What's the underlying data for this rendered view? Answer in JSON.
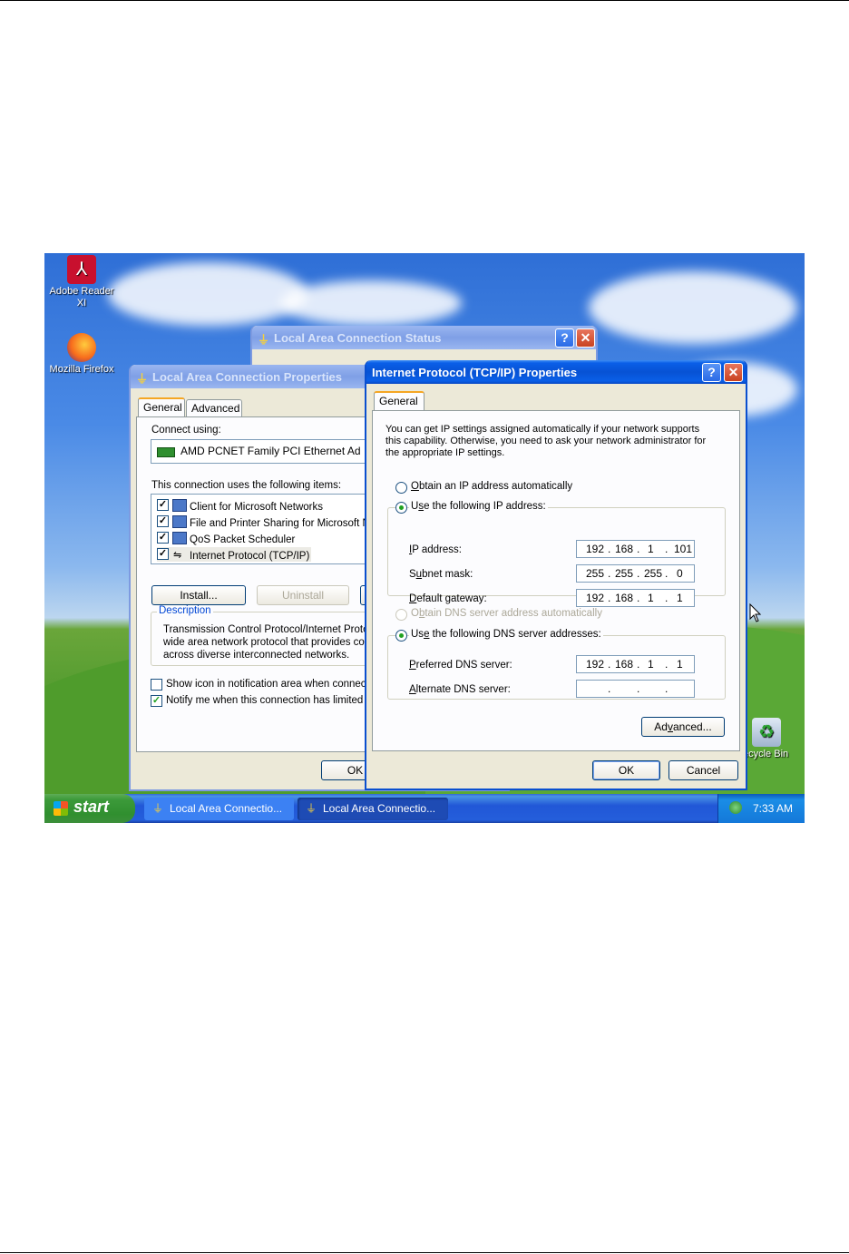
{
  "desktop": {
    "icons": [
      {
        "label": "Adobe Reader XI",
        "icon": "adobe-reader-icon"
      },
      {
        "label": "Mozilla Firefox",
        "icon": "firefox-icon"
      },
      {
        "label": "ecycle Bin",
        "icon": "recycle-bin-icon"
      }
    ]
  },
  "status_window": {
    "title": "Local Area Connection Status",
    "help": "?",
    "close": "✕"
  },
  "lan_props": {
    "title": "Local Area Connection Properties",
    "tabs": [
      "General",
      "Advanced"
    ],
    "connect_using_label": "Connect using:",
    "adapter": "AMD PCNET Family PCI Ethernet Ad",
    "items_label": "This connection uses the following items:",
    "items": [
      {
        "label": "Client for Microsoft Networks",
        "checked": true
      },
      {
        "label": "File and Printer Sharing for Microsoft N",
        "checked": true
      },
      {
        "label": "QoS Packet Scheduler",
        "checked": true
      },
      {
        "label": "Internet Protocol (TCP/IP)",
        "checked": true
      }
    ],
    "install_button": "Install...",
    "uninstall_button": "Uninstall",
    "description_legend": "Description",
    "description_lines": [
      "Transmission Control Protocol/Internet Protoc",
      "wide area network protocol that provides com",
      "across diverse interconnected networks."
    ],
    "show_icon_label": "Show icon in notification area when connect",
    "notify_label": "Notify me when this connection has limited o",
    "ok_button": "OK"
  },
  "tcpip": {
    "title": "Internet Protocol (TCP/IP) Properties",
    "help": "?",
    "close": "✕",
    "tab": "General",
    "intro": [
      "You can get IP settings assigned automatically if your network supports",
      "this capability. Otherwise, you need to ask your network administrator for",
      "the appropriate IP settings."
    ],
    "obtain_ip": {
      "pre": "",
      "key": "O",
      "post": "btain an IP address automatically"
    },
    "use_ip": {
      "pre": "U",
      "key": "s",
      "post": "e the following IP address:"
    },
    "ip_label": {
      "pre": "",
      "key": "I",
      "post": "P address:"
    },
    "subnet_label": {
      "pre": "S",
      "key": "u",
      "post": "bnet mask:"
    },
    "gateway_label": {
      "pre": "",
      "key": "D",
      "post": "efault gateway:"
    },
    "ip_address": [
      "192",
      "168",
      "1",
      "101"
    ],
    "subnet_mask": [
      "255",
      "255",
      "255",
      "0"
    ],
    "default_gateway": [
      "192",
      "168",
      "1",
      "1"
    ],
    "obtain_dns": {
      "pre": "O",
      "key": "b",
      "post": "tain DNS server address automatically"
    },
    "use_dns": {
      "pre": "Us",
      "key": "e",
      "post": " the following DNS server addresses:"
    },
    "preferred_label": {
      "pre": "",
      "key": "P",
      "post": "referred DNS server:"
    },
    "alternate_label": {
      "pre": "",
      "key": "A",
      "post": "lternate DNS server:"
    },
    "preferred_dns": [
      "192",
      "168",
      "1",
      "1"
    ],
    "alternate_dns": [
      "",
      "",
      "",
      ""
    ],
    "advanced_button": {
      "pre": "Ad",
      "key": "v",
      "post": "anced..."
    },
    "ok_button": "OK",
    "cancel_button": "Cancel",
    "dot": "."
  },
  "taskbar": {
    "start": "start",
    "tasks": [
      "Local Area Connectio...",
      "Local Area Connectio..."
    ],
    "clock": "7:33 AM"
  }
}
